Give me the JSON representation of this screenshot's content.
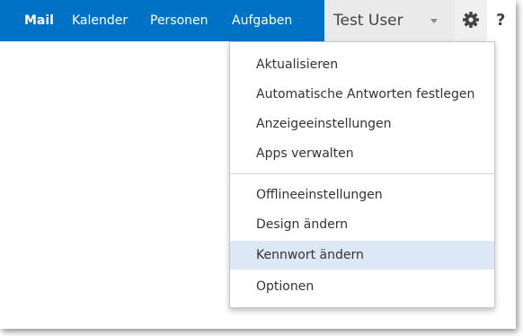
{
  "nav": {
    "items": [
      {
        "label": "Mail",
        "active": true
      },
      {
        "label": "Kalender",
        "active": false
      },
      {
        "label": "Personen",
        "active": false
      },
      {
        "label": "Aufgaben",
        "active": false
      }
    ],
    "color": "#0072c6"
  },
  "user": {
    "name": "Test User",
    "caret_icon": "chevron-down-icon"
  },
  "toolbar": {
    "settings_icon": "gear-icon",
    "help_label": "?"
  },
  "settings_menu": {
    "groups": [
      [
        "Aktualisieren",
        "Automatische Antworten festlegen",
        "Anzeigeeinstellungen",
        "Apps verwalten"
      ],
      [
        "Offlineeinstellungen",
        "Design ändern",
        "Kennwort ändern",
        "Optionen"
      ]
    ],
    "highlighted": "Kennwort ändern",
    "highlight_color": "#dde8f7"
  }
}
